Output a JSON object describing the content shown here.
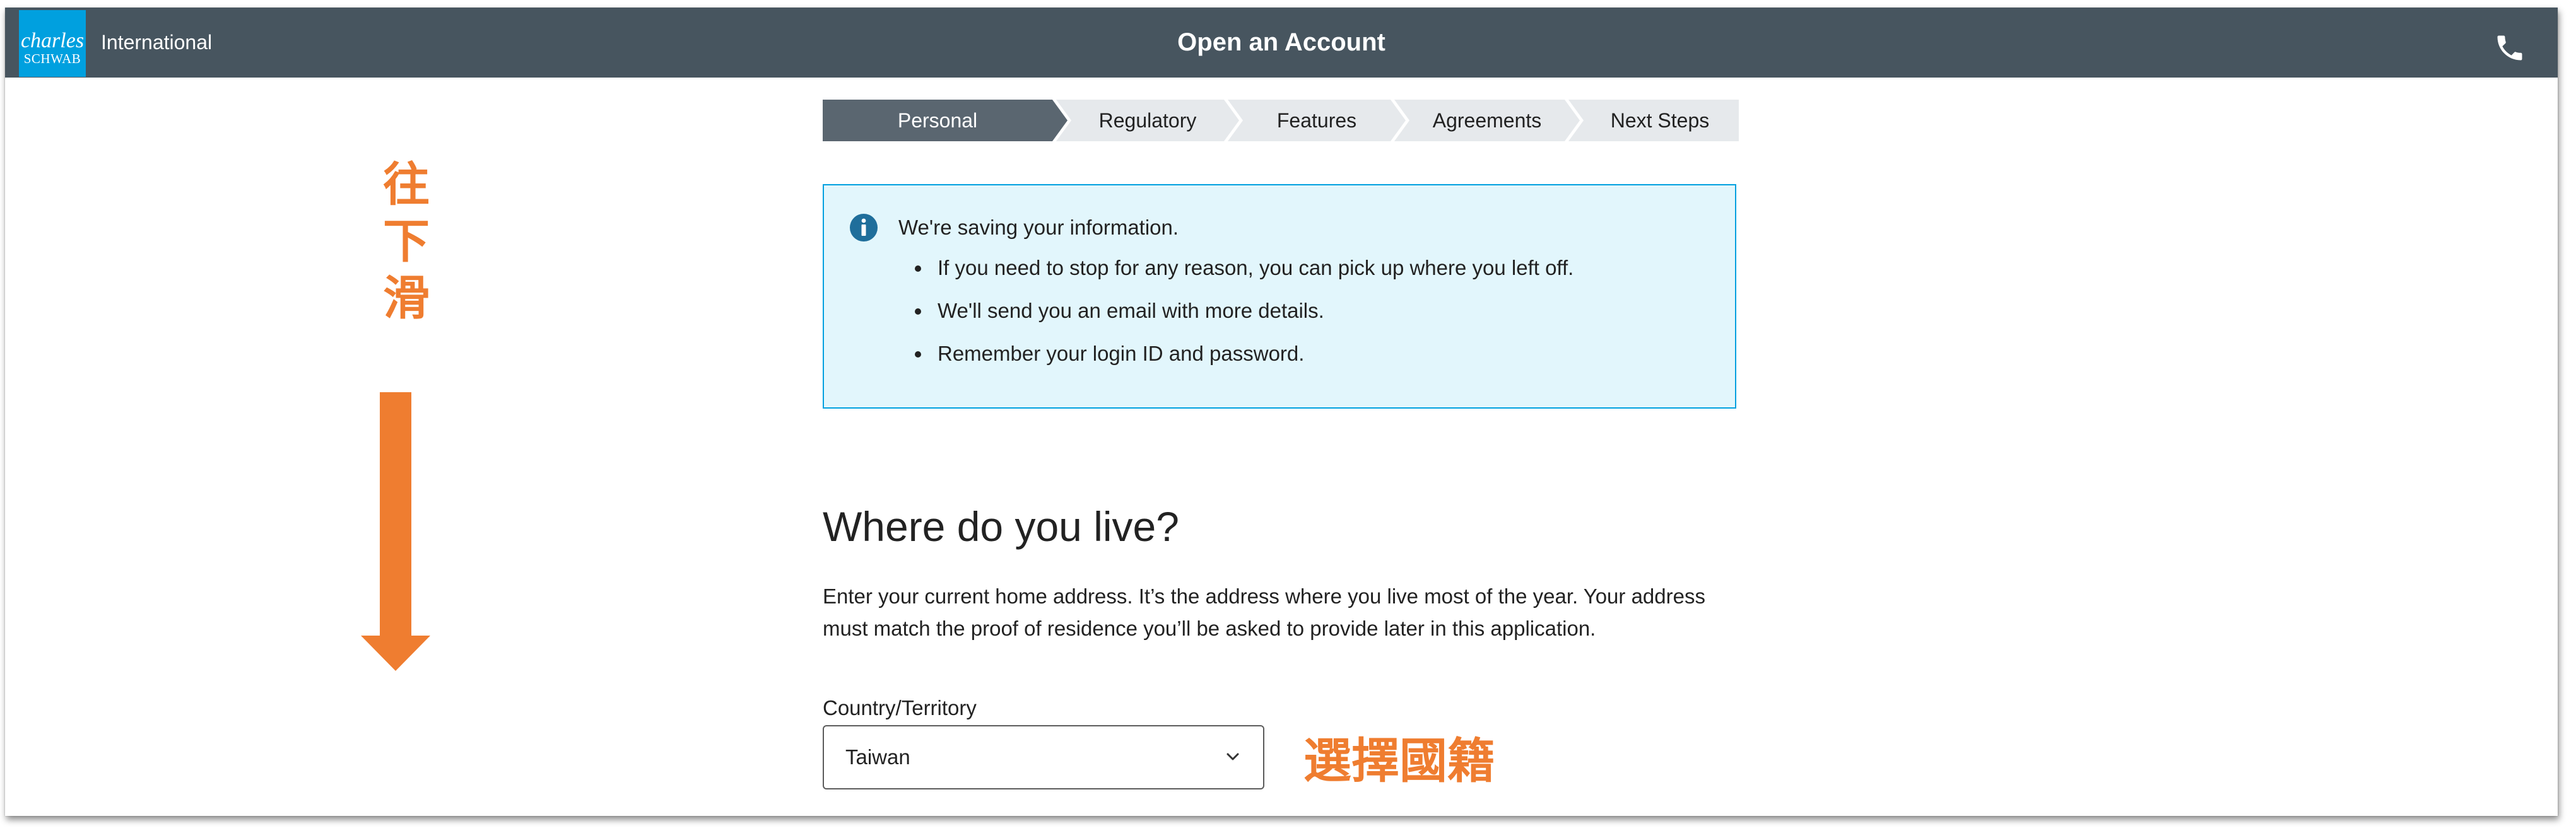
{
  "header": {
    "logo_line1": "charles",
    "logo_line2": "SCHWAB",
    "brand_label": "International",
    "title": "Open an Account",
    "phone_icon": "phone-icon"
  },
  "stepper": {
    "steps": [
      {
        "label": "Personal",
        "active": true
      },
      {
        "label": "Regulatory",
        "active": false
      },
      {
        "label": "Features",
        "active": false
      },
      {
        "label": "Agreements",
        "active": false
      },
      {
        "label": "Next Steps",
        "active": false
      }
    ]
  },
  "info": {
    "icon": "info-icon",
    "heading": "We're saving your information.",
    "items": [
      "If you need to stop for any reason, you can pick up where you left off.",
      "We'll send you an email with more details.",
      "Remember your login ID and password."
    ]
  },
  "main": {
    "title": "Where do you live?",
    "description": "Enter your current home address. It’s the address where you live most of the year. Your address must match the proof of residence you’ll be asked to provide later in this application.",
    "country_label": "Country/Territory",
    "country_value": "Taiwan"
  },
  "annotations": {
    "scroll_chars": [
      "往",
      "下",
      "滑"
    ],
    "select_note": "選擇國籍"
  },
  "colors": {
    "header_bg": "#47555f",
    "logo_bg": "#00a0df",
    "step_active": "#5a6670",
    "step_inactive": "#e6e9ec",
    "info_bg": "#e2f6fc",
    "info_border": "#00a0df",
    "info_icon": "#1f6e9b",
    "annotation": "#ef7d30"
  }
}
